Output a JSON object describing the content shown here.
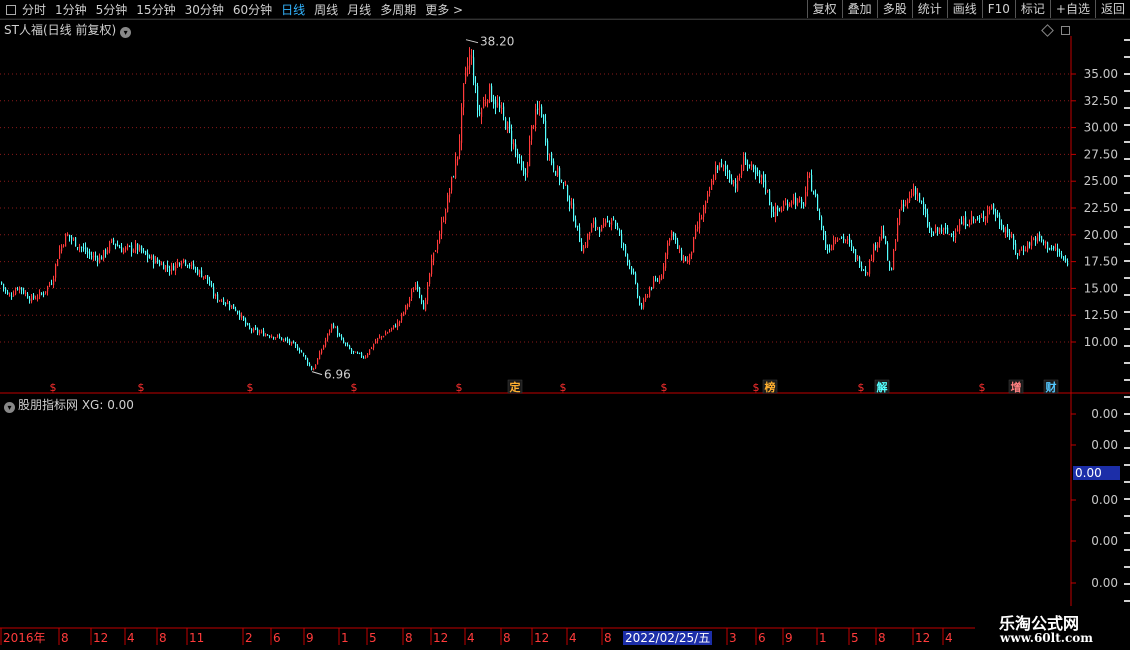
{
  "toolbar": {
    "periods": [
      "分时",
      "1分钟",
      "5分钟",
      "15分钟",
      "30分钟",
      "60分钟",
      "日线",
      "周线",
      "月线",
      "多周期",
      "更多"
    ],
    "more_arrow": ">",
    "active_period": "日线",
    "actions": [
      "复权",
      "叠加",
      "多股",
      "统计",
      "画线",
      "F10",
      "标记",
      "+自选",
      "返回"
    ]
  },
  "main_title": "ST人福(日线 前复权)",
  "sub_title": "股朋指标网 XG: 0.00",
  "watermark": {
    "line1": "乐淘公式网",
    "line2": "www.60lt.com"
  },
  "highlight_date": "2022/02/25/五",
  "colors": {
    "up": "#ff3b3b",
    "down": "#54ffff",
    "grid": "#8a1a1a",
    "axis": "#c00000",
    "price_label": "#c8c8c8",
    "date_highlight": "#1c2ea8"
  },
  "chart_data": [
    {
      "type": "candlestick",
      "title": "ST人福(日线 前复权)",
      "y_ticks": [
        10.0,
        12.5,
        15.0,
        17.5,
        20.0,
        22.5,
        25.0,
        27.5,
        30.0,
        32.5,
        35.0
      ],
      "y_tick_labels": [
        "10.00",
        "12.50",
        "15.00",
        "17.50",
        "20.00",
        "22.50",
        "25.00",
        "27.50",
        "30.00",
        "32.50",
        "35.00"
      ],
      "ylim": [
        6.0,
        39.5
      ],
      "grid": true,
      "annotations": [
        {
          "label": "38.20",
          "value": 38.2,
          "kind": "high"
        },
        {
          "label": "6.96",
          "value": 6.96,
          "kind": "low"
        }
      ],
      "close_path": [
        [
          0,
          15.6
        ],
        [
          8,
          14.2
        ],
        [
          18,
          15.2
        ],
        [
          30,
          14.0
        ],
        [
          42,
          14.5
        ],
        [
          52,
          15.8
        ],
        [
          58,
          18.4
        ],
        [
          66,
          20.0
        ],
        [
          76,
          19.2
        ],
        [
          90,
          18.0
        ],
        [
          100,
          17.8
        ],
        [
          112,
          19.4
        ],
        [
          122,
          18.6
        ],
        [
          136,
          18.8
        ],
        [
          146,
          18.0
        ],
        [
          158,
          17.4
        ],
        [
          170,
          16.8
        ],
        [
          182,
          17.8
        ],
        [
          194,
          16.8
        ],
        [
          206,
          16.0
        ],
        [
          214,
          14.2
        ],
        [
          224,
          13.8
        ],
        [
          236,
          13.0
        ],
        [
          248,
          11.2
        ],
        [
          262,
          10.8
        ],
        [
          276,
          10.5
        ],
        [
          288,
          10.0
        ],
        [
          300,
          9.2
        ],
        [
          312,
          7.3
        ],
        [
          322,
          9.5
        ],
        [
          332,
          11.8
        ],
        [
          340,
          10.2
        ],
        [
          352,
          9.0
        ],
        [
          364,
          8.6
        ],
        [
          376,
          10.2
        ],
        [
          388,
          11.0
        ],
        [
          398,
          11.8
        ],
        [
          408,
          13.8
        ],
        [
          416,
          15.6
        ],
        [
          424,
          13.0
        ],
        [
          430,
          17.0
        ],
        [
          440,
          20.5
        ],
        [
          450,
          24.5
        ],
        [
          458,
          28.0
        ],
        [
          464,
          34.5
        ],
        [
          470,
          37.0
        ],
        [
          478,
          31.0
        ],
        [
          488,
          33.5
        ],
        [
          498,
          31.8
        ],
        [
          508,
          29.8
        ],
        [
          516,
          27.5
        ],
        [
          524,
          25.0
        ],
        [
          532,
          30.5
        ],
        [
          540,
          32.0
        ],
        [
          548,
          27.5
        ],
        [
          558,
          25.5
        ],
        [
          566,
          24.0
        ],
        [
          574,
          21.5
        ],
        [
          582,
          18.5
        ],
        [
          592,
          21.0
        ],
        [
          602,
          20.5
        ],
        [
          612,
          21.8
        ],
        [
          622,
          19.0
        ],
        [
          632,
          16.5
        ],
        [
          640,
          13.0
        ],
        [
          650,
          15.2
        ],
        [
          660,
          16.0
        ],
        [
          670,
          20.5
        ],
        [
          680,
          18.0
        ],
        [
          688,
          17.5
        ],
        [
          696,
          20.5
        ],
        [
          706,
          23.0
        ],
        [
          716,
          26.5
        ],
        [
          726,
          26.0
        ],
        [
          736,
          24.5
        ],
        [
          744,
          27.2
        ],
        [
          754,
          25.5
        ],
        [
          764,
          25.0
        ],
        [
          772,
          22.0
        ],
        [
          782,
          22.5
        ],
        [
          792,
          23.5
        ],
        [
          802,
          22.5
        ],
        [
          808,
          25.5
        ],
        [
          816,
          23.0
        ],
        [
          826,
          18.5
        ],
        [
          836,
          20.0
        ],
        [
          846,
          19.5
        ],
        [
          856,
          17.8
        ],
        [
          866,
          16.5
        ],
        [
          874,
          19.0
        ],
        [
          882,
          20.5
        ],
        [
          890,
          16.0
        ],
        [
          898,
          22.0
        ],
        [
          906,
          23.0
        ],
        [
          914,
          24.5
        ],
        [
          922,
          22.5
        ],
        [
          930,
          20.0
        ],
        [
          940,
          20.5
        ],
        [
          950,
          20.0
        ],
        [
          960,
          21.0
        ],
        [
          970,
          21.5
        ],
        [
          980,
          21.3
        ],
        [
          990,
          22.8
        ],
        [
          1000,
          21.0
        ],
        [
          1008,
          20.2
        ],
        [
          1016,
          18.2
        ],
        [
          1026,
          19.0
        ],
        [
          1036,
          19.8
        ],
        [
          1046,
          19.0
        ],
        [
          1056,
          18.5
        ],
        [
          1068,
          17.0
        ]
      ],
      "event_markers": [
        {
          "x": 53,
          "label": "$",
          "color": "#ff3030"
        },
        {
          "x": 141,
          "label": "$",
          "color": "#ff3030"
        },
        {
          "x": 250,
          "label": "$",
          "color": "#ff3030"
        },
        {
          "x": 354,
          "label": "$",
          "color": "#ff3030"
        },
        {
          "x": 459,
          "label": "$",
          "color": "#ff3030"
        },
        {
          "x": 515,
          "label": "定",
          "color": "#ffb030"
        },
        {
          "x": 563,
          "label": "$",
          "color": "#ff3030"
        },
        {
          "x": 664,
          "label": "$",
          "color": "#ff3030"
        },
        {
          "x": 756,
          "label": "$",
          "color": "#ff3030"
        },
        {
          "x": 770,
          "label": "榜",
          "color": "#ffb030"
        },
        {
          "x": 861,
          "label": "$",
          "color": "#ff3030"
        },
        {
          "x": 882,
          "label": "解",
          "color": "#54ffff"
        },
        {
          "x": 982,
          "label": "$",
          "color": "#ff3030"
        },
        {
          "x": 1016,
          "label": "增",
          "color": "#ff8080"
        },
        {
          "x": 1051,
          "label": "财",
          "color": "#54c8ff"
        }
      ]
    },
    {
      "type": "line",
      "title": "股朋指标网 XG: 0.00",
      "series": [
        {
          "name": "XG",
          "values": [
            0.0
          ]
        }
      ],
      "y_tick_labels": [
        "0.00",
        "0.00",
        "0.00",
        "0.00",
        "0.00"
      ],
      "current_value_label": "0.00"
    }
  ],
  "x_axis": {
    "labels": [
      "2016年",
      "8",
      "12",
      "4",
      "8",
      "11",
      "2",
      "6",
      "9",
      "1",
      "5",
      "8",
      "12",
      "4",
      "8",
      "12",
      "4",
      "8",
      "12",
      "",
      "3",
      "6",
      "9",
      "1",
      "5",
      "8",
      "12",
      "4",
      "7"
    ]
  }
}
